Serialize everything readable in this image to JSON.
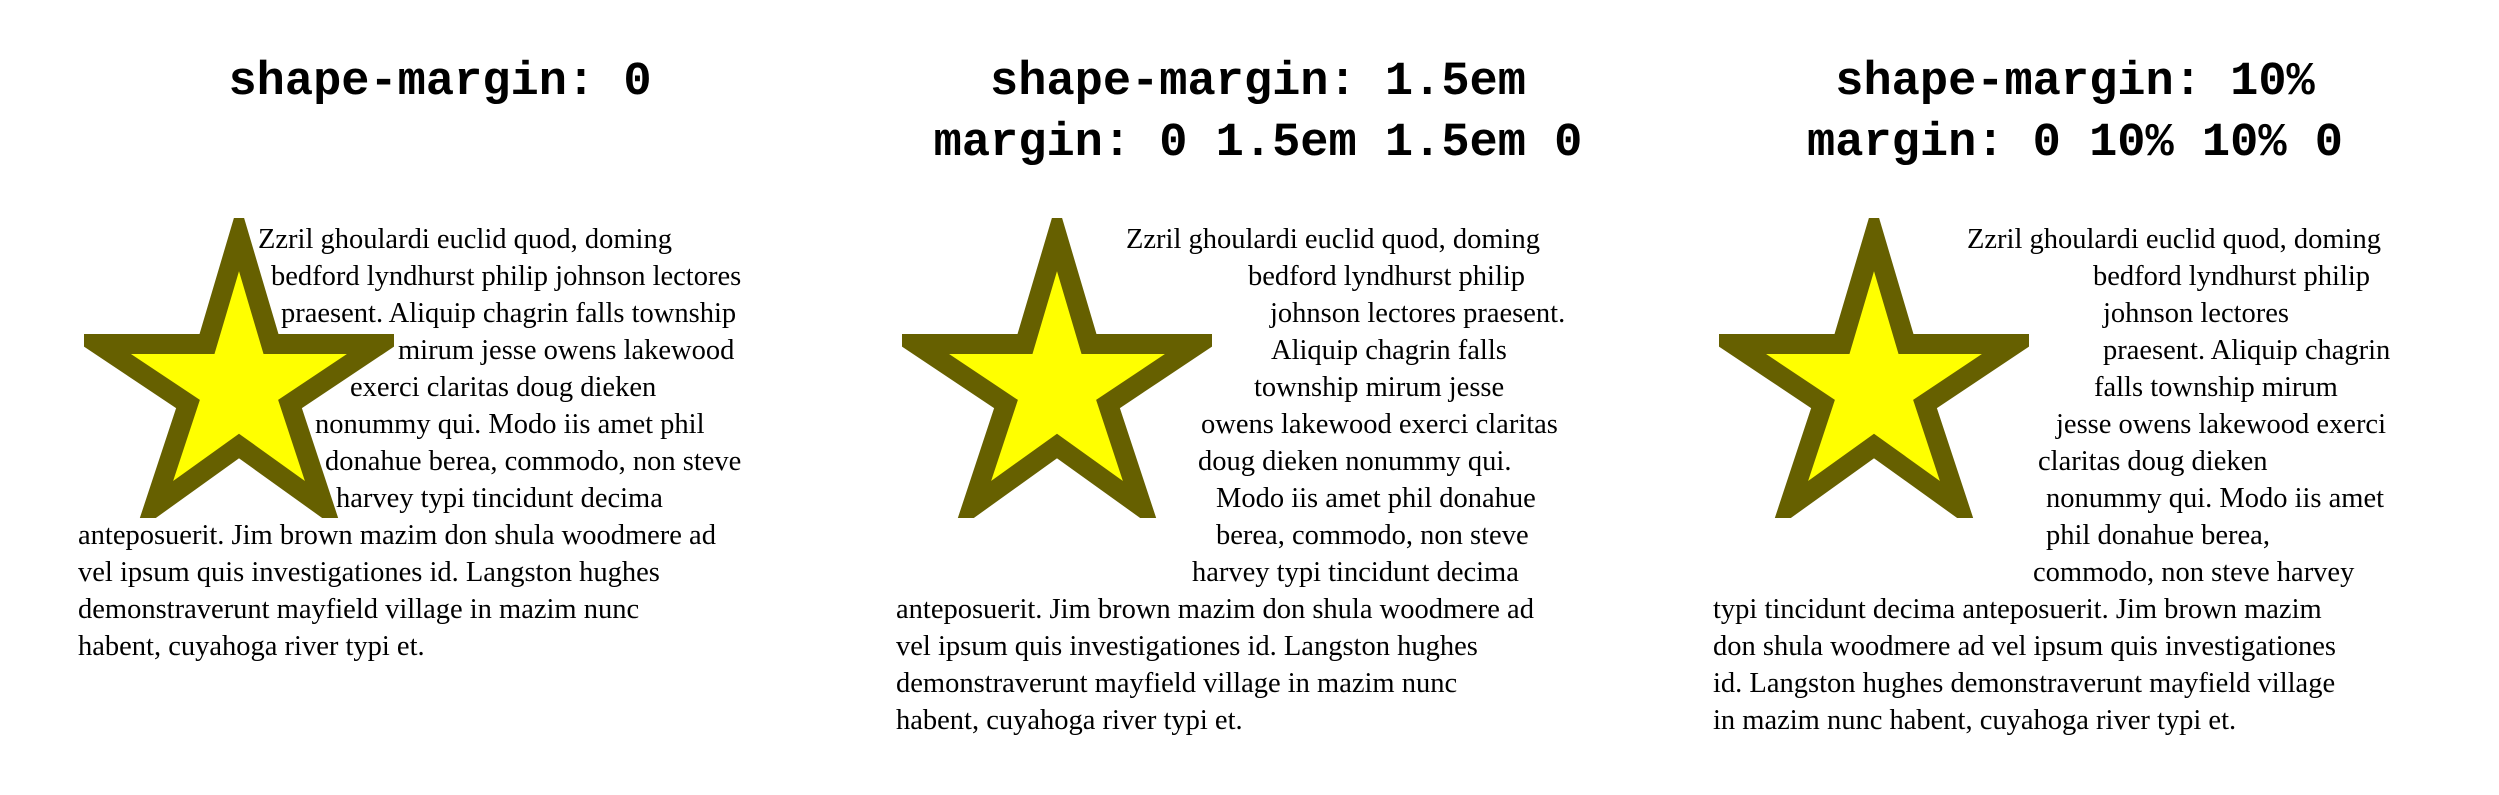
{
  "star_colors": {
    "fill": "#ffff00",
    "stroke": "#666000"
  },
  "panels": [
    {
      "title_lines": [
        "shape-margin: 0"
      ],
      "text_lines": [
        "Zzril ghoulardi euclid quod, doming",
        "bedford lyndhurst philip johnson lectores",
        "praesent. Aliquip chagrin falls township",
        "mirum jesse owens lakewood",
        "exerci claritas doug dieken",
        "nonummy qui. Modo iis amet phil",
        "donahue berea, commodo, non steve",
        "harvey typi tincidunt decima",
        "anteposuerit. Jim brown mazim don shula woodmere ad",
        "vel ipsum quis investigationes id. Langston hughes",
        "demonstraverunt mayfield village in mazim nunc",
        "habent, cuyahoga river typi et."
      ]
    },
    {
      "title_lines": [
        "shape-margin: 1.5em",
        "margin: 0 1.5em 1.5em 0"
      ],
      "text_lines": [
        "Zzril ghoulardi euclid quod, doming",
        "bedford lyndhurst philip",
        "johnson lectores praesent.",
        "Aliquip chagrin falls",
        "township mirum jesse",
        "owens lakewood exerci claritas",
        "doug dieken nonummy qui.",
        "Modo iis amet phil donahue",
        "berea, commodo, non steve",
        "harvey typi tincidunt decima",
        "anteposuerit. Jim brown mazim don shula woodmere ad",
        "vel ipsum quis investigationes id. Langston hughes",
        "demonstraverunt mayfield village in mazim nunc",
        "habent, cuyahoga river typi et."
      ]
    },
    {
      "title_lines": [
        "shape-margin: 10%",
        "margin: 0 10% 10% 0"
      ],
      "text_lines": [
        "Zzril ghoulardi euclid quod, doming",
        "bedford lyndhurst philip",
        "johnson lectores",
        "praesent. Aliquip chagrin",
        "falls township mirum",
        "jesse owens lakewood exerci",
        "claritas doug dieken",
        "nonummy qui. Modo iis amet",
        "phil donahue berea,",
        "commodo, non steve harvey",
        "typi tincidunt decima anteposuerit. Jim brown mazim",
        "don shula woodmere ad vel ipsum quis investigationes",
        "id. Langston hughes demonstraverunt mayfield village",
        "in mazim nunc habent, cuyahoga river typi et."
      ]
    }
  ]
}
